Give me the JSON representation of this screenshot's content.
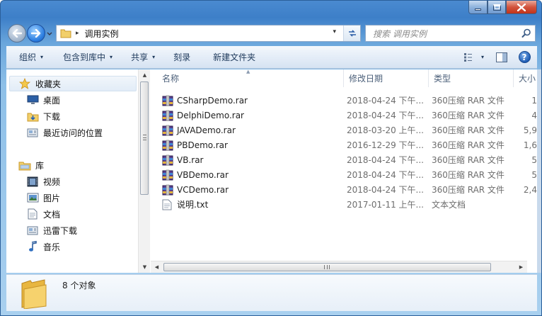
{
  "window": {
    "min_label": "—",
    "max_label": "□",
    "close_label": "✕"
  },
  "address": {
    "separator": "▸",
    "path_segment": "调用实例",
    "dropdown": "▾"
  },
  "search": {
    "placeholder": "搜索 调用实例"
  },
  "toolbar": {
    "organize": "组织",
    "include_in_library": "包含到库中",
    "share": "共享",
    "burn": "刻录",
    "new_folder": "新建文件夹",
    "arrow": "▾",
    "help": "?"
  },
  "nav": {
    "favorites_label": "收藏夹",
    "favorites_items": [
      "桌面",
      "下载",
      "最近访问的位置"
    ],
    "libraries_label": "库",
    "libraries_items": [
      "视频",
      "图片",
      "文档",
      "迅雷下载",
      "音乐"
    ]
  },
  "columns": {
    "name": "名称",
    "date": "修改日期",
    "type": "类型",
    "size": "大小",
    "sort_caret": "▲"
  },
  "files": [
    {
      "name": "CSharpDemo.rar",
      "date": "2018-04-24 下午...",
      "type": "360压缩 RAR 文件",
      "size": "1",
      "icon": "rar-archive-icon"
    },
    {
      "name": "DelphiDemo.rar",
      "date": "2018-04-24 下午...",
      "type": "360压缩 RAR 文件",
      "size": "4",
      "icon": "rar-archive-icon"
    },
    {
      "name": "JAVADemo.rar",
      "date": "2018-03-20 上午...",
      "type": "360压缩 RAR 文件",
      "size": "5,9",
      "icon": "rar-archive-icon"
    },
    {
      "name": "PBDemo.rar",
      "date": "2016-12-29 下午...",
      "type": "360压缩 RAR 文件",
      "size": "1,6",
      "icon": "rar-archive-icon"
    },
    {
      "name": "VB.rar",
      "date": "2018-04-24 下午...",
      "type": "360压缩 RAR 文件",
      "size": "5",
      "icon": "rar-archive-icon"
    },
    {
      "name": "VBDemo.rar",
      "date": "2018-04-24 下午...",
      "type": "360压缩 RAR 文件",
      "size": "5",
      "icon": "rar-archive-icon"
    },
    {
      "name": "VCDemo.rar",
      "date": "2018-04-24 下午...",
      "type": "360压缩 RAR 文件",
      "size": "2,4",
      "icon": "rar-archive-icon"
    },
    {
      "name": "说明.txt",
      "date": "2017-01-11 上午...",
      "type": "文本文档",
      "size": "",
      "icon": "text-document-icon"
    }
  ],
  "scroll": {
    "up": "▲",
    "down": "▼",
    "left": "◀",
    "right": "▶"
  },
  "status": {
    "item_count": "8 个对象"
  },
  "colors": {
    "frame_blue": "#4a8ad0",
    "toolbar_text": "#1e395b",
    "secondary_text": "#6d6d6d"
  }
}
